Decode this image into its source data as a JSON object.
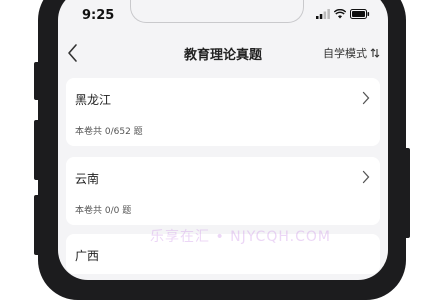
{
  "status_bar": {
    "time": "9:25"
  },
  "nav": {
    "title": "教育理论真题",
    "mode_label": "自学模式"
  },
  "cards": [
    {
      "name": "黑龙江",
      "count": "本卷共 0/652 题"
    },
    {
      "name": "云南",
      "count": "本卷共 0/0 题"
    },
    {
      "name": "广西"
    }
  ],
  "watermark": "乐享在汇 • NJYCQH.COM"
}
